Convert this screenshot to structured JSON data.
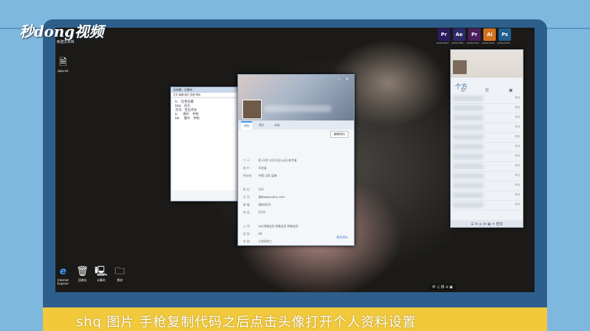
{
  "brand": {
    "logo": "秒dong视频",
    "sublabel": "新建文本档"
  },
  "desktop_icons": [
    {
      "id": "file",
      "label": "data.txt",
      "glyph": "🗎"
    },
    {
      "id": "ie",
      "label": "Internet Explorer",
      "glyph": "e"
    },
    {
      "id": "recycle",
      "label": "回收站",
      "glyph": "🗑"
    },
    {
      "id": "computer",
      "label": "计算机",
      "glyph": "🖳"
    },
    {
      "id": "folder",
      "label": "素材",
      "glyph": "🗀"
    }
  ],
  "taskbar_apps": [
    {
      "name": "Adobe Premiere",
      "abbr": "Pr",
      "color": "#2a1a5e"
    },
    {
      "name": "Adobe After Effects",
      "abbr": "Ae",
      "color": "#2b2a6b"
    },
    {
      "name": "Adobe Premiere",
      "abbr": "Pr",
      "color": "#4a1f5e"
    },
    {
      "name": "Adobe Illustrator",
      "abbr": "Ai",
      "color": "#d1731f"
    },
    {
      "name": "Adobe Photoshop",
      "abbr": "Ps",
      "color": "#1f5f8f"
    }
  ],
  "notepad": {
    "title": "无标题 - 记事本",
    "menu": "文件 编辑 格式 查看 帮助",
    "lines": "b.   红色石墨\nbba   石头\n方向   宝石点光\nb      图片   手枪\nbb     图片   手枪"
  },
  "profile": {
    "tabs": [
      "资料",
      "照片",
      "动态"
    ],
    "edit_button": "编辑资料",
    "fields": [
      {
        "k": "个    人:",
        "v": "男  21岁  1月21日(公历)  射手座"
      },
      {
        "k": "故    乡:",
        "v": "河北省"
      },
      {
        "k": "所在地:",
        "v": "中国 山西 运城"
      },
      {
        "gap": true
      },
      {
        "k": "职    业:",
        "v": "123"
      },
      {
        "k": "主    页:",
        "v": "我的www.sohu.com"
      },
      {
        "k": "邮    箱:",
        "v": "我的QQ号"
      },
      {
        "k": "电    话:",
        "v": "5151"
      },
      {
        "gap": true
      },
      {
        "k": "公    司:",
        "v": "vip   网络会员  网络会员  网络会员"
      },
      {
        "k": "血    型:",
        "v": "28"
      },
      {
        "k": "学    校:",
        "v": "小学同学三"
      }
    ],
    "more_link": "更多资料"
  },
  "qq_panel": {
    "signature": "个方",
    "list_times": [
      "昨天",
      "昨天",
      "昨天",
      "昨天",
      "昨天",
      "昨天",
      "昨天",
      "昨天",
      "昨天",
      "昨天",
      "昨天",
      "昨天"
    ],
    "bottom_icons": "☰ ✉ ◎ ⚙ ▦ ✦ 查找"
  },
  "tray": "中 ♫ 拼 ⊙ ▣",
  "caption": "shq    图片   手枪复制代码之后点击头像打开个人资料设置"
}
